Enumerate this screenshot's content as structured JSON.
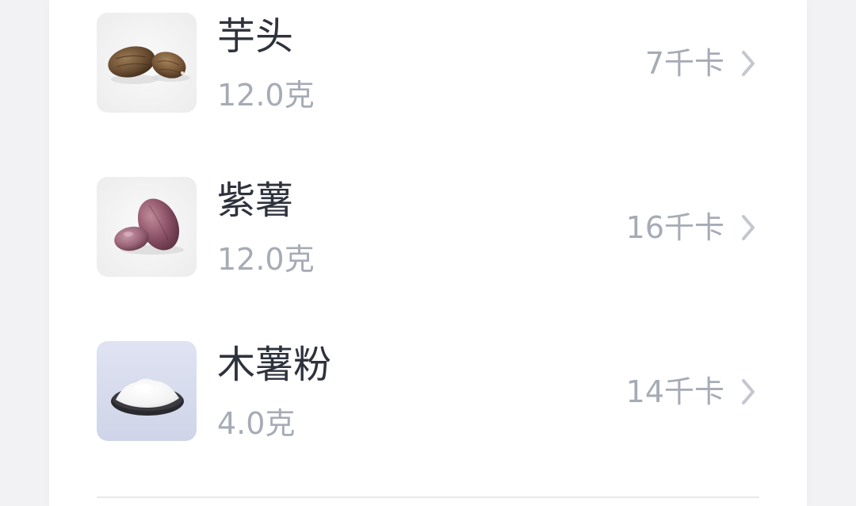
{
  "food_list": [
    {
      "name": "芋头",
      "weight": "12.0克",
      "calories": "7千卡",
      "icon": "taro-icon"
    },
    {
      "name": "紫薯",
      "weight": "12.0克",
      "calories": "16千卡",
      "icon": "purple-sweet-potato-icon"
    },
    {
      "name": "木薯粉",
      "weight": "4.0克",
      "calories": "14千卡",
      "icon": "tapioca-flour-icon"
    }
  ],
  "colors": {
    "title_text": "#2e323c",
    "secondary_text": "#a6abb6",
    "divider": "#e7e8ec"
  }
}
